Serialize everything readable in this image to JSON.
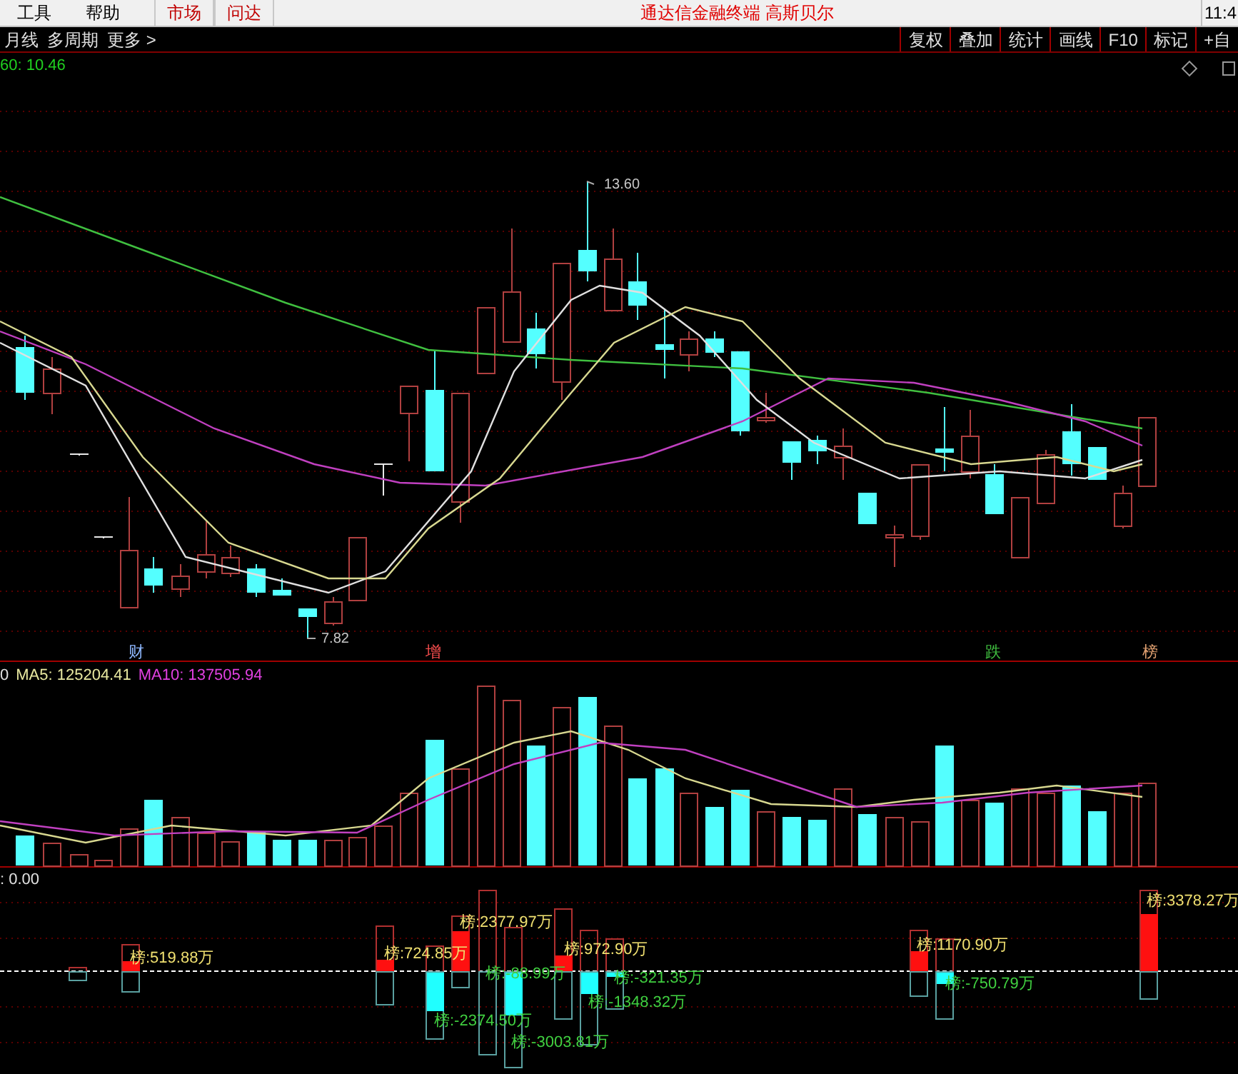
{
  "menu": [
    "工具",
    "帮助"
  ],
  "tabs": [
    {
      "label": "市场",
      "selected": false
    },
    {
      "label": "问达",
      "selected": false
    }
  ],
  "window": {
    "title": "通达信金融终端 高斯贝尔",
    "time": "11:4"
  },
  "period_bar": {
    "left": [
      "月线",
      "多周期",
      "更多 >"
    ],
    "right": [
      "复权",
      "叠加",
      "统计",
      "画线",
      "F10",
      "标记",
      "+自"
    ]
  },
  "price_panel": {
    "header": "60: 10.46",
    "high_label": "13.60",
    "low_label": "7.82",
    "markers": [
      {
        "text": "财",
        "color": "#8fb8ff"
      },
      {
        "text": "增",
        "color": "#ff5050"
      },
      {
        "text": "跌",
        "color": "#40c040"
      },
      {
        "text": "榜",
        "color": "#e0a070"
      }
    ]
  },
  "volume_panel": {
    "header": [
      {
        "text": "0",
        "kind": "plain"
      },
      {
        "text": "MA5: 125204.41",
        "kind": "ma5"
      },
      {
        "text": "MA10: 137505.94",
        "kind": "ma10"
      }
    ]
  },
  "flow_panel": {
    "header": ": 0.00",
    "labels": [
      {
        "text": "榜:3378.27万",
        "kind": "inflow"
      },
      {
        "text": "榜:2377.97万",
        "kind": "inflow"
      },
      {
        "text": "榜:519.88万",
        "kind": "inflow"
      },
      {
        "text": "榜:724.85万",
        "kind": "inflow"
      },
      {
        "text": "榜:972.90万",
        "kind": "inflow"
      },
      {
        "text": "榜:1170.90万",
        "kind": "inflow"
      },
      {
        "text": "榜:-88.99万",
        "kind": "outflow"
      },
      {
        "text": "榜:-321.35万",
        "kind": "outflow"
      },
      {
        "text": "榜:-750.79万",
        "kind": "outflow"
      },
      {
        "text": "榜:-1348.32万",
        "kind": "outflow"
      },
      {
        "text": "榜:-2374.50万",
        "kind": "outflow"
      },
      {
        "text": "榜:-3003.81万",
        "kind": "outflow"
      }
    ]
  }
}
